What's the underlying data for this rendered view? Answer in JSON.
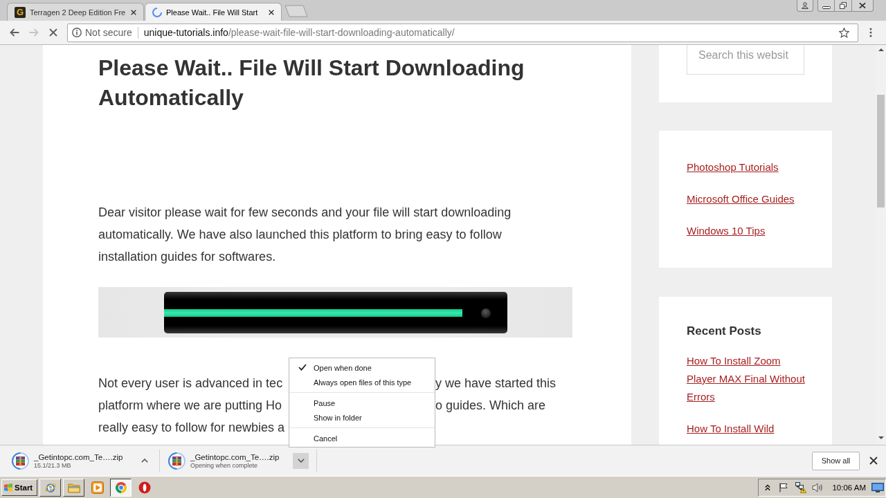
{
  "browser": {
    "tabs": [
      {
        "title": "Terragen 2 Deep Edition Fre",
        "selected": false,
        "favicon": {
          "kind": "letter",
          "text": "G"
        }
      },
      {
        "title": "Please Wait.. File Will Start",
        "selected": true,
        "favicon": {
          "kind": "spinner"
        }
      }
    ],
    "nav_buttons": [
      {
        "kind": "back",
        "disabled": false
      },
      {
        "kind": "forward",
        "disabled": true
      },
      {
        "kind": "stop",
        "disabled": false
      }
    ],
    "address_bar": {
      "security": "Not secure",
      "url_host": "unique-tutorials.info",
      "url_path": "/please-wait-file-will-start-downloading-automatically/"
    }
  },
  "page": {
    "title": "Please Wait.. File Will Start Downloading Automatically",
    "intro": "Dear visitor please wait for few seconds and your file will start downloading automatically. We have also launched this platform to bring easy to follow installation guides for softwares.",
    "progress": {
      "level": 0.87
    },
    "covered_paragraph": [
      {
        "before_menu": "Not every user is advanced in tec",
        "after_menu": "y we have started this"
      },
      {
        "before_menu": "platform where we are putting Ho",
        "after_menu": "o guides. Which are"
      },
      {
        "before_menu": "really easy to follow for newbies a"
      }
    ],
    "sidebar": {
      "search": {
        "placeholder": "Search this websit"
      },
      "category_links": [
        "Photoshop Tutorials",
        "Microsoft Office Guides",
        "Windows 10 Tips"
      ],
      "recent_posts": {
        "title": "Recent Posts",
        "posts": [
          "How To Install Zoom Player MAX Final Without Errors",
          "How To Install Wild"
        ]
      }
    }
  },
  "downloads": {
    "items": [
      {
        "name": "_Getintopc.com_Te….zip",
        "status": "15.1/21.3 MB",
        "menu_open": false
      },
      {
        "name": "_Getintopc.com_Te….zip",
        "status": "Opening when complete",
        "menu_open": true
      }
    ],
    "show_all": "Show all"
  },
  "context_menu": {
    "sections": [
      {
        "items": [
          {
            "label": "Open when done",
            "checked": true
          },
          {
            "label": "Always open files of this type",
            "checked": false
          }
        ]
      },
      {
        "items": [
          {
            "label": "Pause",
            "checked": false
          },
          {
            "label": "Show in folder",
            "checked": false
          }
        ]
      },
      {
        "items": [
          {
            "label": "Cancel",
            "checked": false
          }
        ]
      }
    ]
  },
  "taskbar": {
    "start": "Start",
    "buttons": [
      {
        "kind": "globe",
        "running": true,
        "selected": false
      },
      {
        "kind": "folder",
        "running": true,
        "selected": false
      },
      {
        "kind": "player",
        "running": false,
        "selected": false
      },
      {
        "kind": "pinwheel",
        "running": true,
        "selected": true
      },
      {
        "kind": "red-circle",
        "running": false,
        "selected": false
      }
    ],
    "clock": "10:06 AM"
  }
}
